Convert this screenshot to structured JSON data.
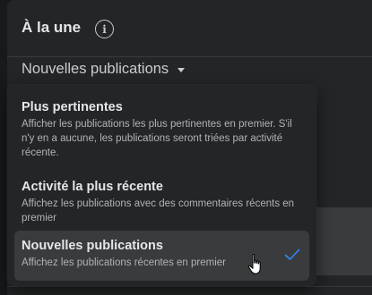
{
  "feed": {
    "title": "À la une",
    "info_icon": "info-icon",
    "sort_label": "Nouvelles publications",
    "sort_caret_icon": "caret-down-icon"
  },
  "menu": {
    "items": [
      {
        "title": "Plus pertinentes",
        "description": "Afficher les publications les plus pertinentes en premier. S'il n'y en a aucune, les publications seront triées par activité récente.",
        "selected": false
      },
      {
        "title": "Activité la plus récente",
        "description": "Affichez les publications avec des commentaires récents en premier",
        "selected": false
      },
      {
        "title": "Nouvelles publications",
        "description": "Affichez les publications récentes en premier",
        "selected": true
      }
    ],
    "selected_icon": "checkmark-icon"
  },
  "colors": {
    "background": "#18191a",
    "surface": "#242526",
    "hover": "#3a3b3c",
    "text_primary": "#e4e6eb",
    "text_secondary": "#b0b3b8",
    "accent": "#2d88ff"
  }
}
